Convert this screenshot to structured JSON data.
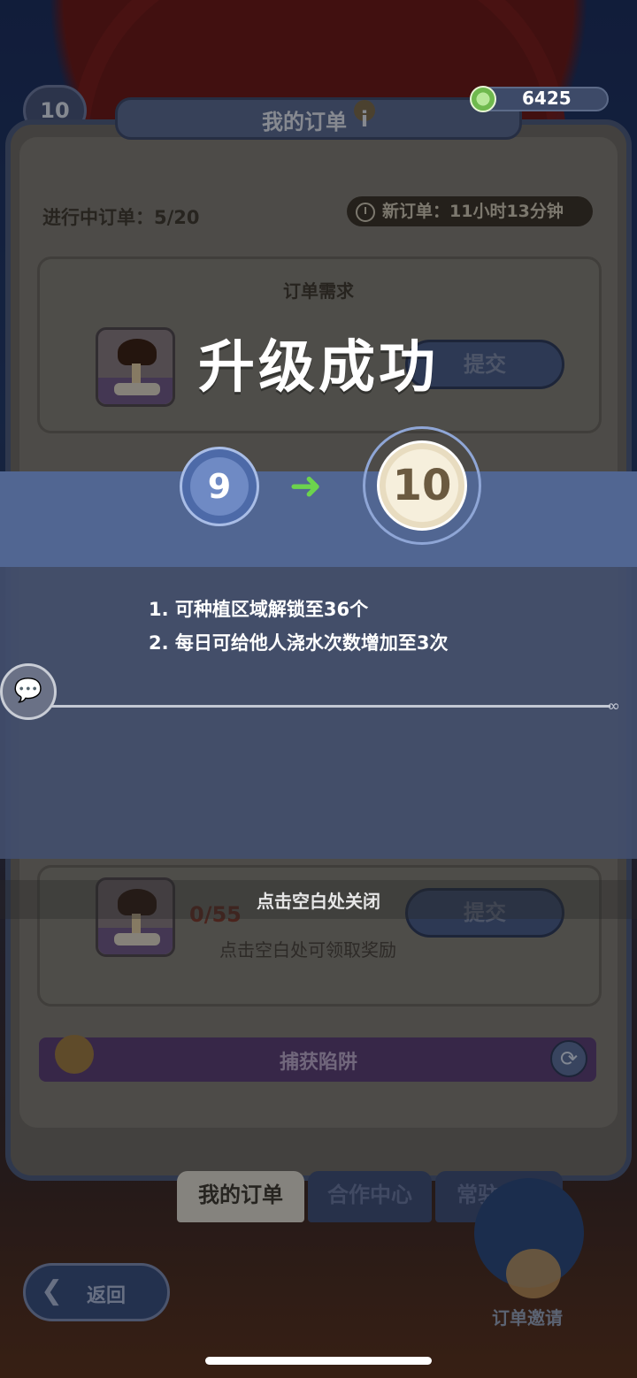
{
  "currency": {
    "icon": "coin-icon",
    "value": "6425"
  },
  "player": {
    "level_badge": "10"
  },
  "panel": {
    "title": "我的订单",
    "info_icon": "i",
    "orders_in_progress": "进行中订单：5/20",
    "new_order_timer": "新订单：11小时13分钟",
    "order_section_title": "订单需求",
    "order1": {
      "submit_label": "提交"
    },
    "order2": {
      "progress": "0/55",
      "hint": "点击空白处可领取奖励",
      "submit_label": "提交"
    },
    "trap_title": "捕获陷阱"
  },
  "tabs": [
    {
      "label": "我的订单",
      "active": true
    },
    {
      "label": "合作中心",
      "active": false
    },
    {
      "label": "常驻收购",
      "active": false
    }
  ],
  "back_label": "返回",
  "invite_label": "订单邀请",
  "level_up": {
    "title": "升级成功",
    "old_level": "9",
    "new_level": "10",
    "perks": [
      "1.  可种植区域解锁至36个",
      "2.  每日可给他人浇水次数增加至3次"
    ],
    "close_hint": "点击空白处关闭"
  },
  "colors": {
    "band": "#516692",
    "arrow": "#6cd34d",
    "coin": "#6fb94e"
  }
}
